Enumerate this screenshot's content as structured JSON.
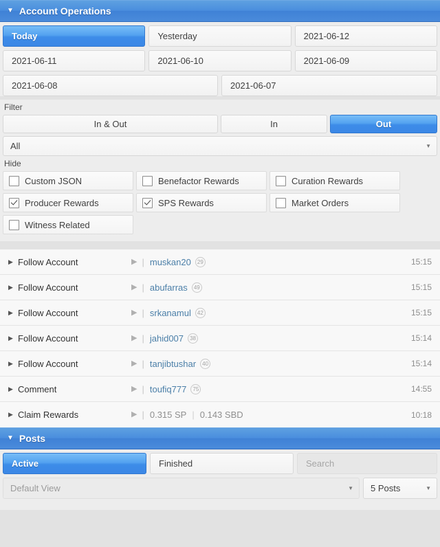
{
  "account_operations": {
    "title": "Account Operations",
    "caret_icon": "caret-down-icon",
    "dates": [
      {
        "label": "Today",
        "active": true
      },
      {
        "label": "Yesterday",
        "active": false
      },
      {
        "label": "2021-06-12",
        "active": false
      },
      {
        "label": "2021-06-11",
        "active": false
      },
      {
        "label": "2021-06-10",
        "active": false
      },
      {
        "label": "2021-06-09",
        "active": false
      },
      {
        "label": "2021-06-08",
        "active": false
      },
      {
        "label": "2021-06-07",
        "active": false
      }
    ],
    "filter": {
      "label": "Filter",
      "segments": [
        {
          "label": "In & Out",
          "active": false
        },
        {
          "label": "In",
          "active": false
        },
        {
          "label": "Out",
          "active": true
        }
      ],
      "select_value": "All",
      "select_arrow_icon": "chevron-down-icon"
    },
    "hide": {
      "label": "Hide",
      "options": [
        {
          "label": "Custom JSON",
          "checked": false
        },
        {
          "label": "Benefactor Rewards",
          "checked": false
        },
        {
          "label": "Curation Rewards",
          "checked": false
        },
        {
          "label": "Producer Rewards",
          "checked": true
        },
        {
          "label": "SPS Rewards",
          "checked": true
        },
        {
          "label": "Market Orders",
          "checked": false
        },
        {
          "label": "Witness Related",
          "checked": false
        }
      ]
    },
    "operations": [
      {
        "type": "Follow Account",
        "user": "muskan20",
        "badge": "29",
        "time": "15:15"
      },
      {
        "type": "Follow Account",
        "user": "abufarras",
        "badge": "49",
        "time": "15:15"
      },
      {
        "type": "Follow Account",
        "user": "srkanamul",
        "badge": "42",
        "time": "15:15"
      },
      {
        "type": "Follow Account",
        "user": "jahid007",
        "badge": "38",
        "time": "15:14"
      },
      {
        "type": "Follow Account",
        "user": "tanjibtushar",
        "badge": "40",
        "time": "15:14"
      },
      {
        "type": "Comment",
        "user": "toufiq777",
        "badge": "75",
        "time": "14:55"
      },
      {
        "type": "Claim Rewards",
        "amount1": "0.315 SP",
        "amount2": "0.143 SBD",
        "time": "10:18"
      }
    ]
  },
  "posts": {
    "title": "Posts",
    "caret_icon": "caret-down-icon",
    "tabs": [
      {
        "label": "Active",
        "active": true
      },
      {
        "label": "Finished",
        "active": false
      }
    ],
    "search_placeholder": "Search",
    "view_select": "Default View",
    "count_select": "5 Posts"
  },
  "colors": {
    "accent": "#3d8ce8",
    "header_blue": "#4a8ede",
    "page_bg": "#e2e2e2",
    "panel_bg": "#ededed",
    "link": "#4b7fa8"
  }
}
